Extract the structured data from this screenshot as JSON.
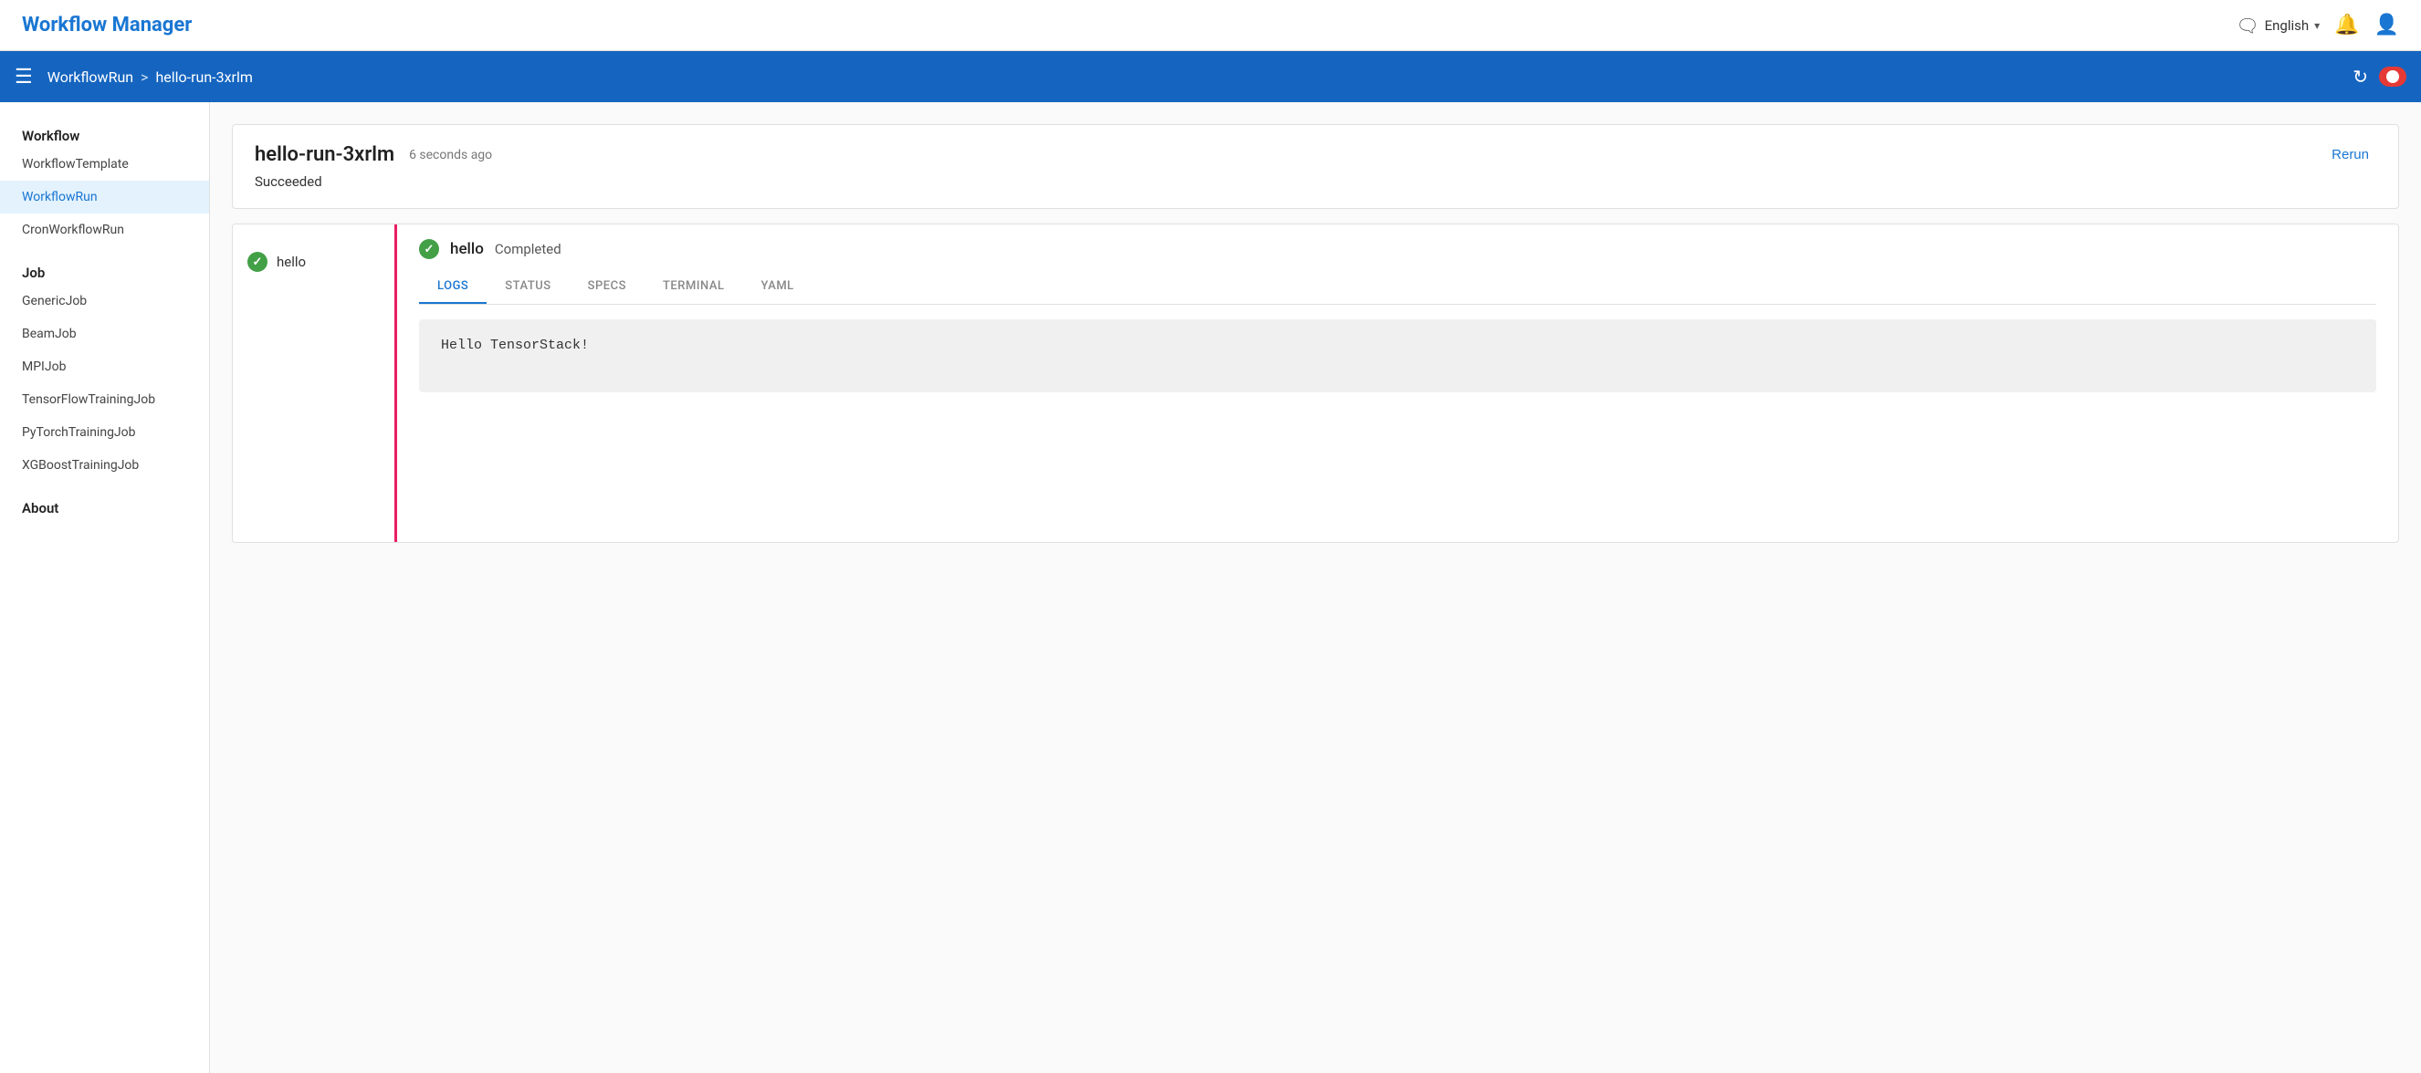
{
  "header": {
    "title": "Workflow Manager",
    "lang": "English",
    "lang_icon": "🌐",
    "chevron": "▾"
  },
  "subheader": {
    "breadcrumb_root": "WorkflowRun",
    "breadcrumb_separator": ">",
    "breadcrumb_current": "hello-run-3xrlm"
  },
  "sidebar": {
    "section_workflow": "Workflow",
    "items_workflow": [
      {
        "label": "WorkflowTemplate",
        "id": "workflowtemplate"
      },
      {
        "label": "WorkflowRun",
        "id": "workflowrun",
        "active": true
      },
      {
        "label": "CronWorkflowRun",
        "id": "cronworkflowrun"
      }
    ],
    "section_job": "Job",
    "items_job": [
      {
        "label": "GenericJob",
        "id": "genericjob"
      },
      {
        "label": "BeamJob",
        "id": "beamjob"
      },
      {
        "label": "MPIJob",
        "id": "mpijob"
      },
      {
        "label": "TensorFlowTrainingJob",
        "id": "tensorflowtrainingjob"
      },
      {
        "label": "PyTorchTrainingJob",
        "id": "pytorchtrainingjob"
      },
      {
        "label": "XGBoostTrainingJob",
        "id": "xgboosttrainingjob"
      }
    ],
    "section_about": "About"
  },
  "run": {
    "name": "hello-run-3xrlm",
    "time_ago": "6 seconds ago",
    "status": "Succeeded",
    "rerun_label": "Rerun"
  },
  "job": {
    "name": "hello",
    "detail_name": "hello",
    "detail_status": "Completed"
  },
  "tabs": [
    {
      "label": "LOGS",
      "active": true
    },
    {
      "label": "STATUS"
    },
    {
      "label": "SPECS"
    },
    {
      "label": "TERMINAL"
    },
    {
      "label": "YAML"
    }
  ],
  "log": {
    "content": "Hello TensorStack!"
  }
}
